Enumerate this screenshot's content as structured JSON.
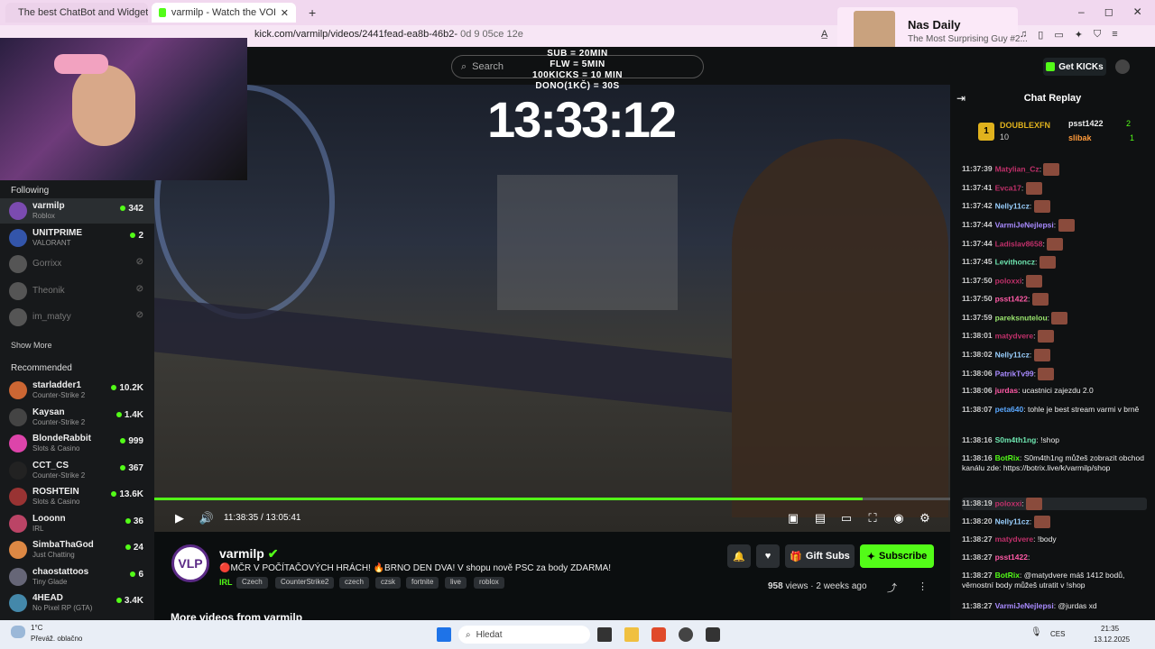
{
  "browser": {
    "tabs": [
      {
        "title": "The best ChatBot and Widgets for Ki"
      },
      {
        "title": "varmilp - Watch the VOD on K"
      }
    ],
    "url": "kick.com/varmilp/videos/2441fead-ea8b-46b2-",
    "url_suffix": "0d  9 05ce  12e",
    "media_popup": {
      "title": "Nas Daily",
      "subtitle": "The Most Surprising Guy #2..."
    }
  },
  "header": {
    "search_placeholder": "Search",
    "get_kicks": "Get KICKs"
  },
  "overlay": {
    "lines": [
      "SUB = 20MIN",
      "FLW = 5MIN",
      "100KICKS = 10 MIN",
      "DONO(1KČ) = 30S"
    ],
    "timer": "13:33:12"
  },
  "sidebar": {
    "following_label": "Following",
    "following": [
      {
        "name": "varmilp",
        "game": "Roblox",
        "count": "342",
        "live": true,
        "color": "#7b4bb0"
      },
      {
        "name": "UNITPRIME",
        "game": "VALORANT",
        "count": "2",
        "live": true,
        "color": "#3355aa"
      },
      {
        "name": "Gorrixx",
        "game": "",
        "count": "",
        "live": false,
        "color": "#555"
      },
      {
        "name": "Theonik",
        "game": "",
        "count": "",
        "live": false,
        "color": "#555"
      },
      {
        "name": "im_matyy",
        "game": "",
        "count": "",
        "live": false,
        "color": "#555"
      }
    ],
    "show_more": "Show More",
    "recommended_label": "Recommended",
    "recommended": [
      {
        "name": "starladder1",
        "game": "Counter-Strike 2",
        "count": "10.2K",
        "color": "#c63"
      },
      {
        "name": "Kaysan",
        "game": "Counter-Strike 2",
        "count": "1.4K",
        "color": "#444"
      },
      {
        "name": "BlondeRabbit",
        "game": "Slots & Casino",
        "count": "999",
        "color": "#d4a"
      },
      {
        "name": "CCT_CS",
        "game": "Counter-Strike 2",
        "count": "367",
        "color": "#222"
      },
      {
        "name": "ROSHTEIN",
        "game": "Slots & Casino",
        "count": "13.6K",
        "color": "#933"
      },
      {
        "name": "Looonn",
        "game": "IRL",
        "count": "36",
        "color": "#b46"
      },
      {
        "name": "SimbaThaGod",
        "game": "Just Chatting",
        "count": "24",
        "color": "#d84"
      },
      {
        "name": "chaostattoos",
        "game": "Tiny Glade",
        "count": "6",
        "color": "#667"
      },
      {
        "name": "4HEAD",
        "game": "No Pixel RP (GTA)",
        "count": "3.4K",
        "color": "#48a"
      }
    ]
  },
  "player": {
    "time_current": "11:38:35",
    "time_total": "13:05:41",
    "progress_fraction": 0.89
  },
  "channel": {
    "logo_text": "VLP",
    "name": "varmilp",
    "title": "🔴MČR V POČÍTAČOVÝCH HRÁCH! 🔥BRNO DEN DVA! V shopu nově PSC za body ZDARMA!",
    "category": "IRL",
    "tags": [
      "Czech",
      "CounterStrike2",
      "czech",
      "czsk",
      "fortnite",
      "live",
      "roblox"
    ],
    "gift_subs": "Gift Subs",
    "subscribe": "Subscribe",
    "views_count": "958",
    "views_label": "views",
    "age": "2 weeks ago",
    "more_videos": "More videos from varmilp"
  },
  "chat": {
    "title": "Chat Replay",
    "top": [
      {
        "rank": "1",
        "name": "DOUBLEXFN",
        "value": "10"
      },
      {
        "name": "psst1422",
        "value": "2"
      },
      {
        "name": "slibak",
        "value": "1"
      }
    ],
    "messages": [
      {
        "t": "11:37:39",
        "u": "Matylian_Cz",
        "c": "#c0306a",
        "m": ""
      },
      {
        "t": "11:37:41",
        "u": "Evca17",
        "c": "#c0306a",
        "m": ""
      },
      {
        "t": "11:37:42",
        "u": "Nelly11cz",
        "c": "#9ad0ff",
        "m": ""
      },
      {
        "t": "11:37:44",
        "u": "VarmiJeNejlepsi",
        "c": "#a98bff",
        "m": ""
      },
      {
        "t": "11:37:44",
        "u": "Ladislav8658",
        "c": "#c0306a",
        "m": ""
      },
      {
        "t": "11:37:45",
        "u": "Levithoncz",
        "c": "#6ee6b0",
        "m": ""
      },
      {
        "t": "11:37:50",
        "u": "poloxxi",
        "c": "#c0306a",
        "m": ""
      },
      {
        "t": "11:37:50",
        "u": "psst1422",
        "c": "#ff5aa6",
        "m": ""
      },
      {
        "t": "11:37:59",
        "u": "pareksnutelou",
        "c": "#9ae66e",
        "m": ""
      },
      {
        "t": "11:38:01",
        "u": "matydvere",
        "c": "#c0306a",
        "m": ""
      },
      {
        "t": "11:38:02",
        "u": "Nelly11cz",
        "c": "#9ad0ff",
        "m": ""
      },
      {
        "t": "11:38:06",
        "u": "PatrikTv99",
        "c": "#a98bff",
        "m": ""
      },
      {
        "t": "11:38:06",
        "u": "jurdas",
        "c": "#ff5aa6",
        "m": "ucastnici zajezdu 2.0"
      },
      {
        "t": "11:38:07",
        "u": "peta640",
        "c": "#5aa8ff",
        "m": "tohle je best stream varmi v brně"
      },
      {
        "t": "11:38:16",
        "u": "S0m4th1ng",
        "c": "#6ee6b0",
        "m": "!shop"
      },
      {
        "t": "11:38:16",
        "u": "BotRix",
        "c": "#53fc18",
        "m": "S0m4th1ng můžeš zobrazit obchod kanálu zde: https://botrix.live/k/varmilp/shop"
      },
      {
        "t": "11:38:19",
        "u": "poloxxi",
        "c": "#c0306a",
        "m": ""
      },
      {
        "t": "11:38:20",
        "u": "Nelly11cz",
        "c": "#9ad0ff",
        "m": ""
      },
      {
        "t": "11:38:27",
        "u": "matydvere",
        "c": "#c0306a",
        "m": "!body"
      },
      {
        "t": "11:38:27",
        "u": "psst1422",
        "c": "#ff5aa6",
        "m": ""
      },
      {
        "t": "11:38:27",
        "u": "BotRix",
        "c": "#53fc18",
        "m": "@matydvere máš 1412 bodů, věrnostní body můžeš utratit v !shop"
      },
      {
        "t": "11:38:27",
        "u": "VarmiJeNejlepsi",
        "c": "#a98bff",
        "m": "@jurdas xd"
      }
    ]
  },
  "taskbar": {
    "weather_temp": "1°C",
    "weather_desc": "Převáž. oblačno",
    "search_placeholder": "Hledat",
    "lang": "CES",
    "time": "21:35",
    "date": "13.12.2025"
  }
}
